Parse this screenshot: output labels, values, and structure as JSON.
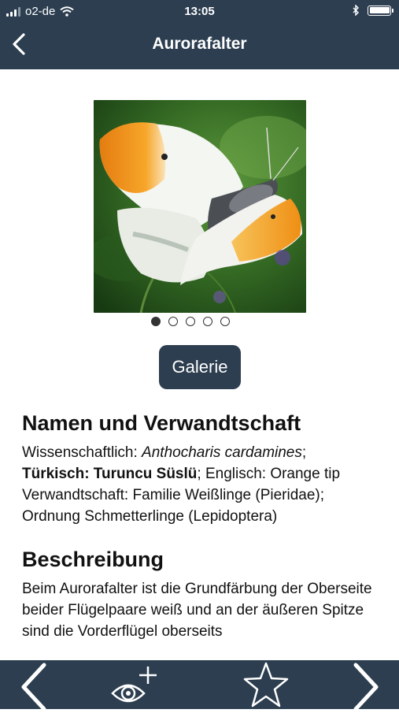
{
  "status_bar": {
    "carrier": "o2-de",
    "time": "13:05"
  },
  "nav": {
    "title": "Aurorafalter",
    "back_icon": "chevron-left-icon"
  },
  "gallery": {
    "image_alt": "Aurorafalter",
    "dots_total": 5,
    "dots_active": 1,
    "button_label": "Galerie"
  },
  "section_names": {
    "heading": "Namen und Verwandtschaft",
    "sci_label": "Wissenschaftlich: ",
    "sci_value": "Anthocharis cardamines",
    "sci_end": ";",
    "turkish": "Türkisch: Turuncu Süslü",
    "english": "; Englisch: Orange tip",
    "family": "Verwandtschaft: Familie Weißlinge (Pieridae);",
    "order": "Ordnung Schmetterlinge (Lepidoptera)"
  },
  "section_description": {
    "heading": "Beschreibung",
    "text": "Beim Aurorafalter ist die Grundfärbung der Oberseite beider Flügelpaare weiß und an der äußeren Spitze sind die Vorderflügel oberseits"
  },
  "toolbar": {
    "prev_icon": "chevron-left-icon",
    "observe_icon": "eye-plus-icon",
    "favorite_icon": "star-icon",
    "next_icon": "chevron-right-icon"
  },
  "colors": {
    "bar": "#2c3e50",
    "orange": "#f39a1d"
  }
}
